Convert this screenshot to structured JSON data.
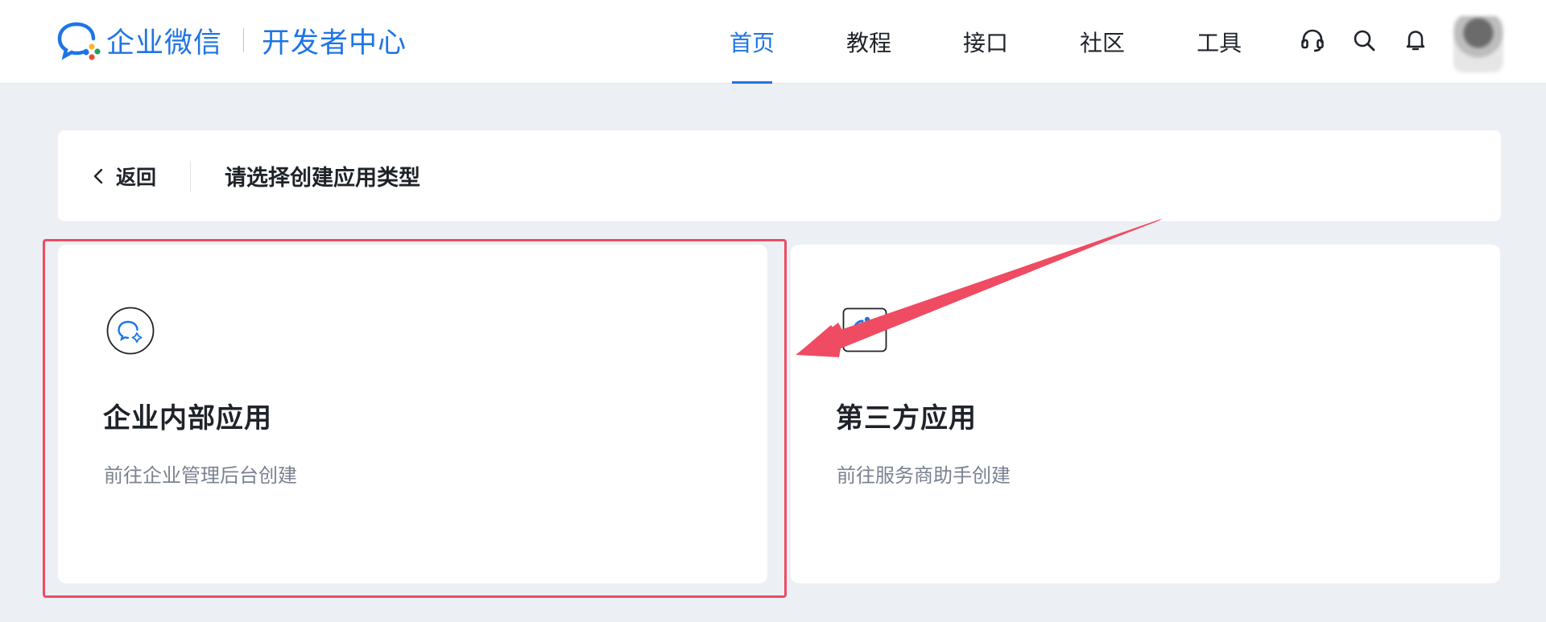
{
  "header": {
    "brand_name": "企业微信",
    "brand_sub": "开发者中心",
    "nav": [
      {
        "label": "首页",
        "active": true
      },
      {
        "label": "教程",
        "active": false
      },
      {
        "label": "接口",
        "active": false
      },
      {
        "label": "社区",
        "active": false
      },
      {
        "label": "工具",
        "active": false
      }
    ],
    "tools": [
      "headset-icon",
      "search-icon",
      "bell-icon"
    ],
    "accent_color": "#1e74e6"
  },
  "crumb": {
    "back_label": "返回",
    "title": "请选择创建应用类型"
  },
  "cards": [
    {
      "title": "企业内部应用",
      "desc": "前往企业管理后台创建",
      "icon": "wecom-chat-icon"
    },
    {
      "title": "第三方应用",
      "desc": "前往服务商助手创建",
      "icon": "third-party-app-icon"
    }
  ],
  "annotation": {
    "highlight_color": "#ef4b62"
  }
}
